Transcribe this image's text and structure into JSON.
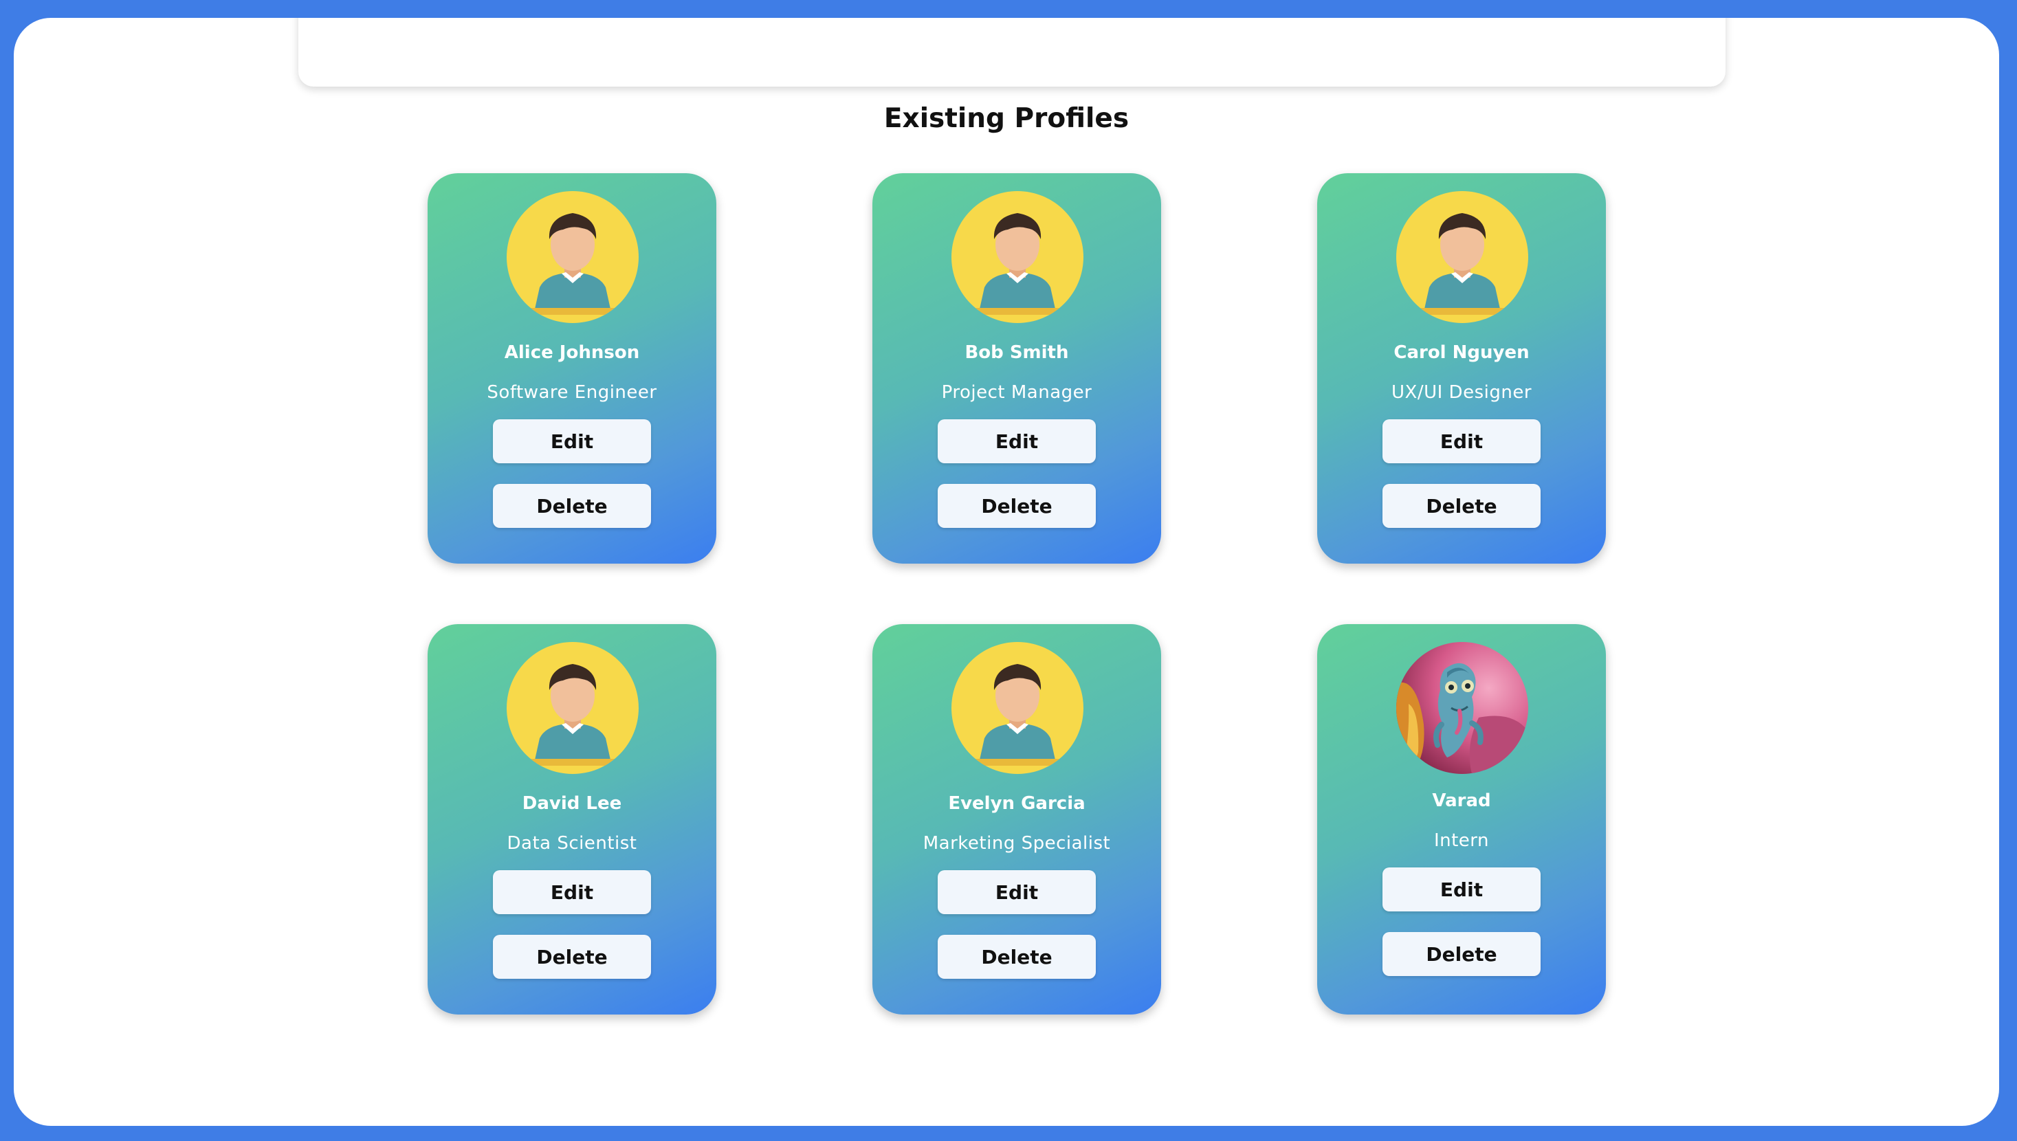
{
  "section_title": "Existing Profiles",
  "profiles": [
    {
      "name": "Alice Johnson",
      "role": "Software Engineer",
      "avatar": "default-person-icon",
      "edit_label": "Edit",
      "delete_label": "Delete"
    },
    {
      "name": "Bob Smith",
      "role": "Project Manager",
      "avatar": "default-person-icon",
      "edit_label": "Edit",
      "delete_label": "Delete"
    },
    {
      "name": "Carol Nguyen",
      "role": "UX/UI Designer",
      "avatar": "default-person-icon",
      "edit_label": "Edit",
      "delete_label": "Delete"
    },
    {
      "name": "David Lee",
      "role": "Data Scientist",
      "avatar": "default-person-icon",
      "edit_label": "Edit",
      "delete_label": "Delete"
    },
    {
      "name": "Evelyn Garcia",
      "role": "Marketing Specialist",
      "avatar": "default-person-icon",
      "edit_label": "Edit",
      "delete_label": "Delete"
    },
    {
      "name": "Varad",
      "role": "Intern",
      "avatar": "chameleon-photo",
      "edit_label": "Edit",
      "delete_label": "Delete"
    }
  ],
  "colors": {
    "background": "#3f7de6",
    "card_gradient_start": "#62d09a",
    "card_gradient_end": "#3b7ef0",
    "avatar_bg": "#f7d94a",
    "button_bg": "#f1f6fc",
    "submit_button": "#4f7ee9"
  }
}
